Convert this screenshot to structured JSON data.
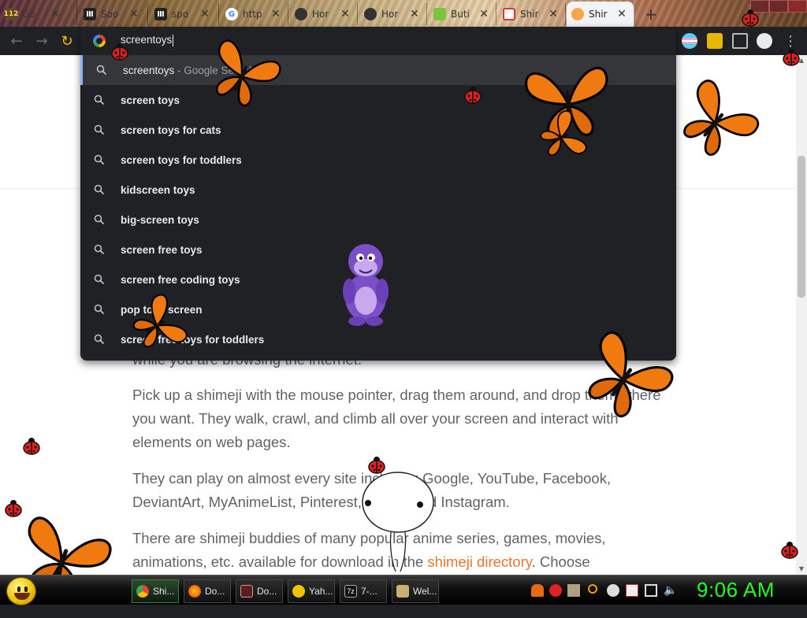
{
  "tabs": [
    {
      "title": "Go",
      "badge": "112"
    },
    {
      "title": "Soo"
    },
    {
      "title": "spo"
    },
    {
      "title": "http"
    },
    {
      "title": "Hor"
    },
    {
      "title": "Hor"
    },
    {
      "title": "Buti"
    },
    {
      "title": "Shir"
    },
    {
      "title": "Shir"
    }
  ],
  "omnibox": {
    "query": "screentoys",
    "suggestions": [
      {
        "bold": "",
        "text": "screentoys",
        "source": " - Google Search"
      },
      {
        "bold": "screen toys",
        "text": "",
        "source": ""
      },
      {
        "bold": "screen toys for cats",
        "text": "",
        "source": ""
      },
      {
        "bold": "screen toys for toddlers",
        "text": "",
        "source": ""
      },
      {
        "bold": "kidscreen toys",
        "text": "",
        "source": ""
      },
      {
        "bold": "big-screen toys",
        "text": "",
        "source": ""
      },
      {
        "bold": "screen free toys",
        "text": "",
        "source": ""
      },
      {
        "bold": "screen free coding toys",
        "text": "",
        "source": ""
      },
      {
        "bold": "pop toys screen",
        "text": "",
        "source": ""
      },
      {
        "bold": "screen free toys for toddlers",
        "text": "",
        "source": ""
      }
    ]
  },
  "page": {
    "p0": "while you are browsing the internet.",
    "p1": "Pick up a shimeji with the mouse pointer, drag them around, and drop them where you want. They walk, crawl, and climb all over your screen and interact with elements on web pages.",
    "p2": "They can play on almost every site including Google, YouTube, Facebook, DeviantArt, MyAnimeList, Pinterest, Twitter and Instagram.",
    "p3_pre": "There are shimeji buddies of many popular anime series, games, movies, animations, etc. available for download in the ",
    "p3_link": "shimeji directory",
    "p3_post": ". Choose"
  },
  "taskbar": {
    "items": [
      {
        "label": "Shi..."
      },
      {
        "label": "Do..."
      },
      {
        "label": "Do..."
      },
      {
        "label": "Yah..."
      },
      {
        "label": "7-..."
      },
      {
        "label": "Wel..."
      }
    ],
    "seven_zip_label": "7z",
    "clock": "9:06 AM"
  },
  "colors": {
    "omnibox_bg": "#202124",
    "selected_row": "#35363a",
    "link": "#e8762c",
    "clock": "#22ff22",
    "butterfly": "#f07a10"
  }
}
